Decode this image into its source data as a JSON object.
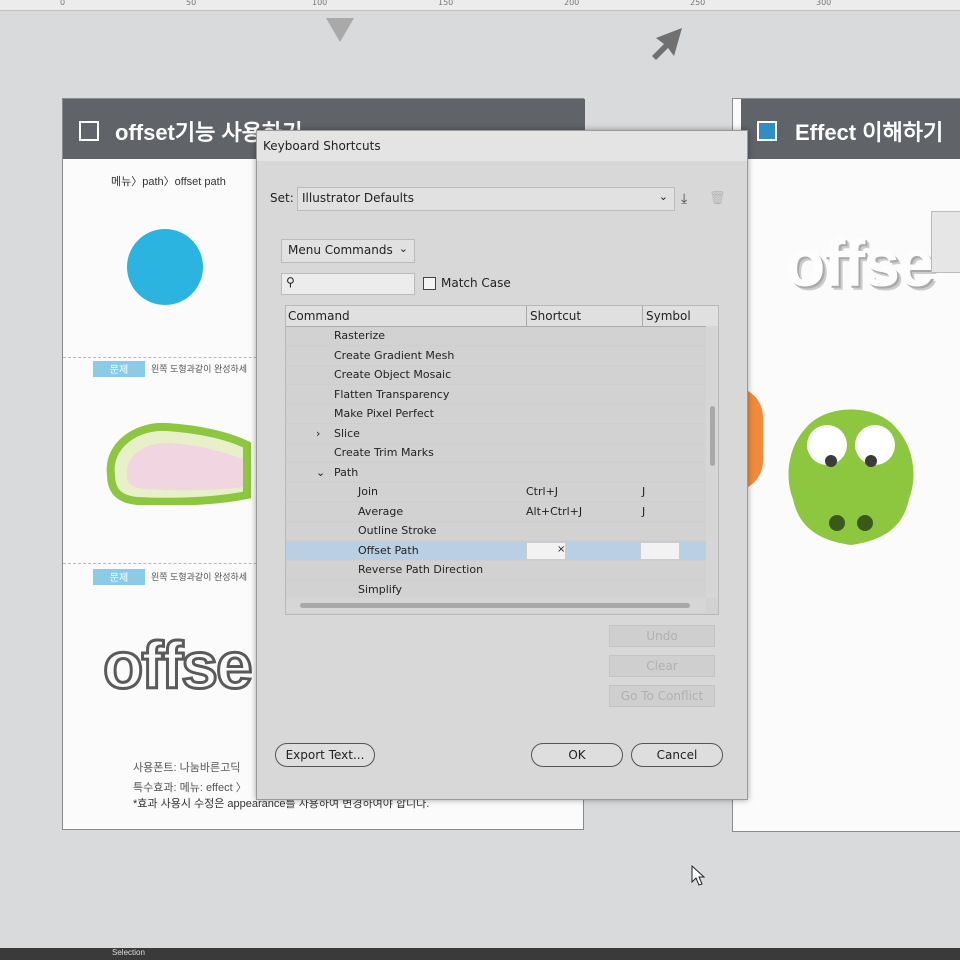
{
  "ruler_ticks": [
    "0",
    "50",
    "100",
    "150",
    "200",
    "250",
    "300"
  ],
  "left_board": {
    "title": "offset기능 사용하기",
    "menu_path": "메뉴〉path〉offset path",
    "q1_tag": "문제",
    "q1_text": "왼쪽 도형과같이 완성하세",
    "q2_tag": "문제",
    "q2_text": "왼쪽 도형과같이 완성하세",
    "offset_art": "offse",
    "note1": "사용폰트: 나눔바른고딕",
    "note2": "특수효과: 메뉴: effect 〉",
    "note3": "*효과 사용시 수정은 appearance를 사용하여 변경하여야 합니다."
  },
  "right_board": {
    "title": "Effect 이해하기",
    "offset_art": "offse"
  },
  "dialog": {
    "title": "Keyboard Shortcuts",
    "set_label": "Set:",
    "set_value": "Illustrator Defaults",
    "category": "Menu Commands",
    "search_placeholder": "",
    "match_case": "Match Case",
    "columns": [
      "Command",
      "Shortcut",
      "Symbol"
    ],
    "rows": [
      {
        "name": "Rasterize",
        "level": 1,
        "shortcut": "",
        "symbol": "",
        "arrow": ""
      },
      {
        "name": "Create Gradient Mesh",
        "level": 1,
        "shortcut": "",
        "symbol": "",
        "arrow": ""
      },
      {
        "name": "Create Object Mosaic",
        "level": 1,
        "shortcut": "",
        "symbol": "",
        "arrow": ""
      },
      {
        "name": "Flatten Transparency",
        "level": 1,
        "shortcut": "",
        "symbol": "",
        "arrow": ""
      },
      {
        "name": "Make Pixel Perfect",
        "level": 1,
        "shortcut": "",
        "symbol": "",
        "arrow": ""
      },
      {
        "name": "Slice",
        "level": 1,
        "shortcut": "",
        "symbol": "",
        "arrow": ">"
      },
      {
        "name": "Create Trim Marks",
        "level": 1,
        "shortcut": "",
        "symbol": "",
        "arrow": ""
      },
      {
        "name": "Path",
        "level": 1,
        "shortcut": "",
        "symbol": "",
        "arrow": "v"
      },
      {
        "name": "Join",
        "level": 2,
        "shortcut": "Ctrl+J",
        "symbol": "J",
        "arrow": ""
      },
      {
        "name": "Average",
        "level": 2,
        "shortcut": "Alt+Ctrl+J",
        "symbol": "J",
        "arrow": ""
      },
      {
        "name": "Outline Stroke",
        "level": 2,
        "shortcut": "",
        "symbol": "",
        "arrow": ""
      },
      {
        "name": "Offset Path",
        "level": 2,
        "shortcut": "",
        "symbol": "",
        "arrow": "",
        "selected": true
      },
      {
        "name": "Reverse Path Direction",
        "level": 2,
        "shortcut": "",
        "symbol": "",
        "arrow": ""
      },
      {
        "name": "Simplify",
        "level": 2,
        "shortcut": "",
        "symbol": "",
        "arrow": ""
      }
    ],
    "undo_label": "Undo",
    "clear_label": "Clear",
    "conflict_label": "Go To Conflict",
    "export_label": "Export Text...",
    "ok_label": "OK",
    "cancel_label": "Cancel"
  },
  "status_text": "Selection",
  "colors": {
    "header": "#606469",
    "accent": "#2f8fc4",
    "selected_row": "#b9cfe3",
    "circle": "#2bb4e0",
    "croc": "#8dc63f"
  }
}
